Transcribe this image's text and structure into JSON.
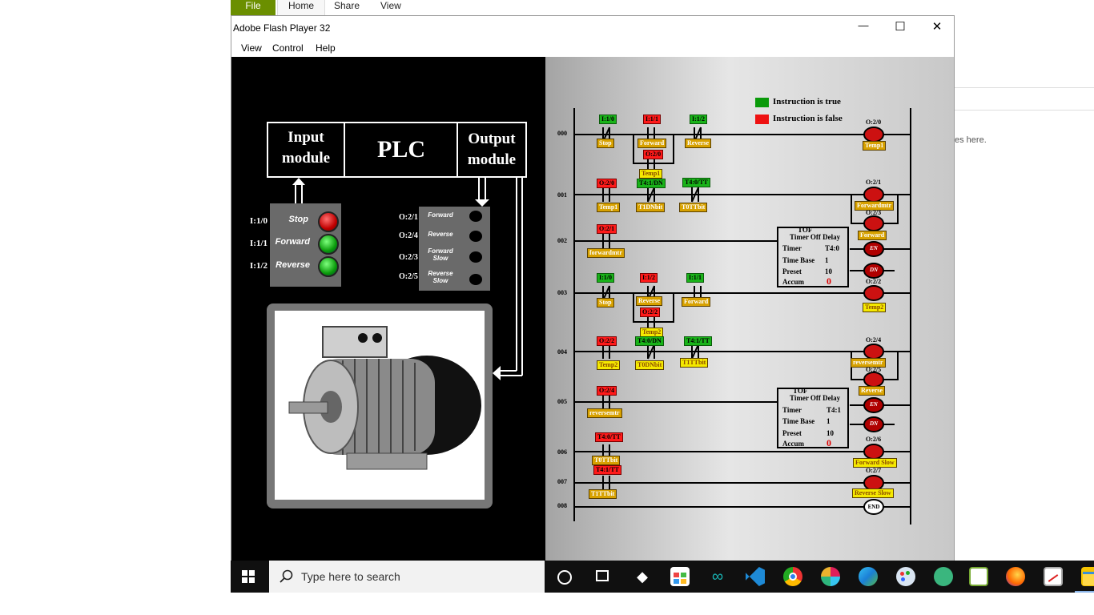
{
  "explorer": {
    "tabs": [
      "File",
      "Home",
      "Share",
      "View"
    ],
    "partial_text": "es here."
  },
  "window": {
    "title": "Adobe Flash Player 32",
    "menu": [
      "View",
      "Control",
      "Help"
    ],
    "controls": {
      "minimize": "—",
      "maximize": "☐",
      "close": "✕"
    }
  },
  "left": {
    "input_module": "Input module",
    "plc": "PLC",
    "output_module": "Output module",
    "inputs": [
      {
        "addr": "I:1/0",
        "name": "Stop",
        "color": "#cc1111"
      },
      {
        "addr": "I:1/1",
        "name": "Forward",
        "color": "#11aa11"
      },
      {
        "addr": "I:1/2",
        "name": "Reverse",
        "color": "#11aa11"
      }
    ],
    "outputs": [
      {
        "addr": "O:2/1",
        "name": "Forward"
      },
      {
        "addr": "O:2/4",
        "name": "Reverse"
      },
      {
        "addr": "O:2/3",
        "name": "Forward Slow"
      },
      {
        "addr": "O:2/5",
        "name": "Reverse Slow"
      }
    ],
    "motor_icon": "electric-motor"
  },
  "ladder": {
    "legend": {
      "true_label": "Instruction is true",
      "false_label": "Instruction is false",
      "true_color": "#0a9a0a",
      "false_color": "#ee1111"
    },
    "rungs": [
      "000",
      "001",
      "002",
      "003",
      "004",
      "005",
      "006",
      "007",
      "008"
    ],
    "r000": {
      "c1_addr": "I:1/0",
      "c1_name": "Stop",
      "c2_addr": "I:1/1",
      "c2_name": "Forward",
      "c2b_addr": "O:2/0",
      "c2b_name": "Temp1",
      "c3_addr": "I:1/2",
      "c3_name": "Reverse",
      "out_addr": "O:2/0",
      "out_name": "Temp1"
    },
    "r001": {
      "c1_addr": "O:2/0",
      "c1_name": "Temp1",
      "c2_addr": "T4:1/DN",
      "c2_name": "T1DNbit",
      "c3_addr": "T4:0/TT",
      "c3_name": "T0TTbit",
      "out1_addr": "O:2/1",
      "out1_name": "Forwardmtr",
      "out2_addr": "O:2/3",
      "out2_name": "Forward"
    },
    "r002": {
      "c1_addr": "O:2/1",
      "c1_name": "forwardmtr",
      "tof_type": "TOF",
      "tof_title": "Timer Off Delay",
      "timer_k": "Timer",
      "timer_v": "T4:0",
      "tb_k": "Time Base",
      "tb_v": "1",
      "preset_k": "Preset",
      "preset_v": "10",
      "accum_k": "Accum",
      "accum_v": "0",
      "en": "EN",
      "dn": "DN"
    },
    "r003": {
      "c1_addr": "I:1/0",
      "c1_name": "Stop",
      "c2_addr": "I:1/2",
      "c2_name": "Reverse",
      "c2b_addr": "O:2/2",
      "c2b_name": "Temp2",
      "c3_addr": "I:1/1",
      "c3_name": "Forward",
      "out_addr": "O:2/2",
      "out_name": "Temp2"
    },
    "r004": {
      "c1_addr": "O:2/2",
      "c1_name": "Temp2",
      "c2_addr": "T4:0/DN",
      "c2_name": "T0DNbit",
      "c3_addr": "T4:1/TT",
      "c3_name": "T1TTbit",
      "out1_addr": "O:2/4",
      "out1_name": "reversemtr",
      "out2_addr": "O:2/5",
      "out2_name": "Reverse"
    },
    "r005": {
      "c1_addr": "O:2/4",
      "c1_name": "reversemtr",
      "tof_type": "TOF",
      "tof_title": "Timer Off Delay",
      "timer_k": "Timer",
      "timer_v": "T4:1",
      "tb_k": "Time Base",
      "tb_v": "1",
      "preset_k": "Preset",
      "preset_v": "10",
      "accum_k": "Accum",
      "accum_v": "0",
      "en": "EN",
      "dn": "DN"
    },
    "r006": {
      "c1_addr": "T4:0/TT",
      "c1_name": "T0TTbit",
      "out_addr": "O:2/6",
      "out_name": "Forward Slow"
    },
    "r007": {
      "c1_addr": "T4:1/TT",
      "c1_name": "T1TTbit",
      "out_addr": "O:2/7",
      "out_name": "Reverse Slow"
    },
    "r008": {
      "end": "END"
    }
  },
  "taskbar": {
    "search_placeholder": "Type here to search",
    "icons": [
      "windows-start-icon",
      "cortana-icon",
      "task-view-icon",
      "dropbox-icon",
      "store-icon",
      "arduino-icon",
      "vscode-icon",
      "chrome-icon",
      "slack-icon",
      "edge-icon",
      "paint-icon",
      "atom-icon",
      "notepad-icon",
      "firefox-icon",
      "screenshot-icon",
      "explorer-icon"
    ]
  }
}
